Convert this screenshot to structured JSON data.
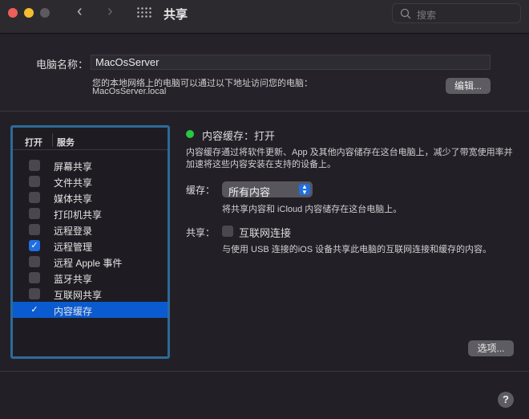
{
  "toolbar": {
    "title": "共享",
    "search_placeholder": "搜索"
  },
  "computer_name": {
    "label": "电脑名称：",
    "value": "MacOsServer",
    "description": "您的本地网络上的电脑可以通过以下地址访问您的电脑：",
    "address": "MacOsServer.local",
    "edit_label": "编辑..."
  },
  "services": {
    "col_on": "打开",
    "col_service": "服务",
    "items": [
      {
        "label": "屏幕共享",
        "checked": false
      },
      {
        "label": "文件共享",
        "checked": false
      },
      {
        "label": "媒体共享",
        "checked": false
      },
      {
        "label": "打印机共享",
        "checked": false
      },
      {
        "label": "远程登录",
        "checked": false
      },
      {
        "label": "远程管理",
        "checked": true
      },
      {
        "label": "远程 Apple 事件",
        "checked": false
      },
      {
        "label": "蓝牙共享",
        "checked": false
      },
      {
        "label": "互联网共享",
        "checked": false
      },
      {
        "label": "内容缓存",
        "checked": true,
        "selected": true
      }
    ]
  },
  "detail": {
    "status": "内容缓存：打开",
    "status_color": "#28c840",
    "description": "内容缓存通过将软件更新、App 及其他内容储存在这台电脑上，减少了带宽使用率并加速将这些内容安装在支持的设备上。",
    "cache_label": "缓存：",
    "cache_value": "所有内容",
    "cache_note": "将共享内容和 iCloud 内容储存在这台电脑上。",
    "share_label": "共享：",
    "share_option": "互联网连接",
    "share_note": "与使用 USB 连接的iOS 设备共享此电脑的互联网连接和缓存的内容。",
    "options_label": "选项..."
  },
  "help": "?"
}
